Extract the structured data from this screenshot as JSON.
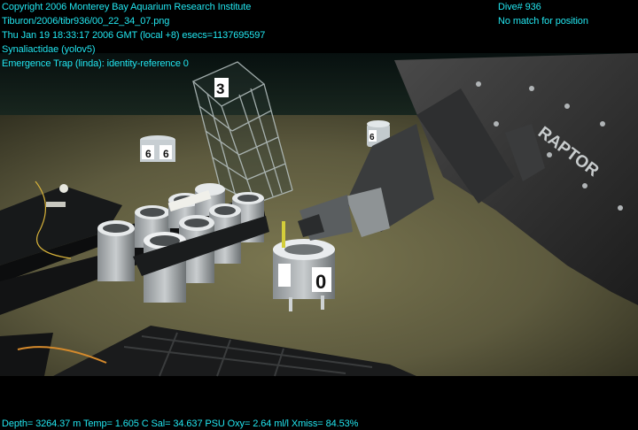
{
  "overlay": {
    "top_left": [
      "Copyright 2006 Monterey Bay Aquarium Research Institute",
      "Tiburon/2006/tibr936/00_22_34_07.png",
      "Thu Jan 19 18:33:17 2006 GMT (local +8)  esecs=1137695597",
      "Synaliactidae (yolov5)",
      "Emergence Trap (linda): identity-reference 0"
    ],
    "top_right": [
      "Dive# 936",
      "No match for position"
    ],
    "bottom": "Depth= 3264.37 m  Temp= 1.605 C  Sal= 34.637 PSU  Oxy= 2.64 ml/l  Xmiss= 84.53%"
  },
  "scene": {
    "markers": {
      "cage": "3",
      "left_buoy": "6",
      "right_buoy": "6",
      "trap": "0"
    },
    "arm_label": "RAPTOR"
  },
  "colors": {
    "overlay_text": "#22e6f0",
    "seafloor": "#5d5a3e",
    "water": "#0c1e1e"
  }
}
